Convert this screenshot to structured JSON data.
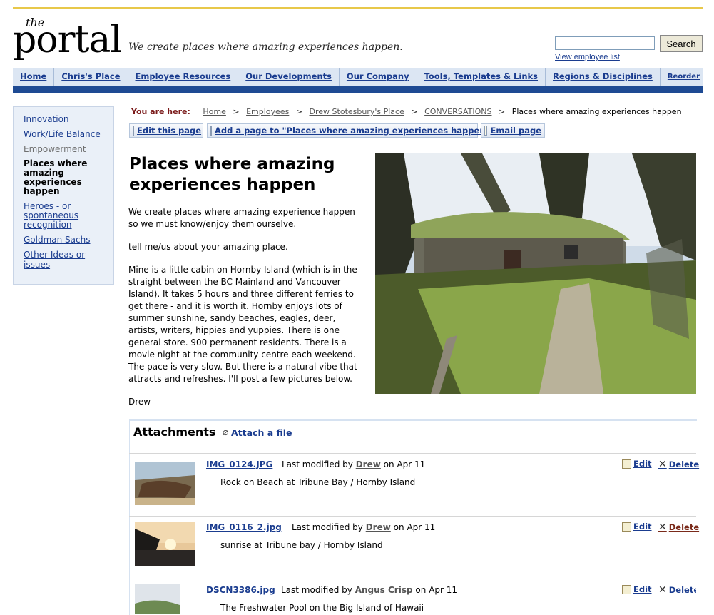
{
  "logo": {
    "the": "the",
    "portal": "portal"
  },
  "tagline": "We create places where amazing experiences happen.",
  "search": {
    "button": "Search",
    "employee_link": "View employee list"
  },
  "nav": [
    {
      "label": "Home"
    },
    {
      "label": "Chris's Place"
    },
    {
      "label": "Employee Resources"
    },
    {
      "label": "Our Developments"
    },
    {
      "label": "Our Company"
    },
    {
      "label": "Tools, Templates & Links"
    },
    {
      "label": "Regions & Disciplines"
    },
    {
      "label": "Reorder"
    }
  ],
  "sidebar": {
    "innovation": "Innovation",
    "worklife": "Work/Life Balance",
    "empowerment": "Empowerment",
    "current": "Places where amazing experiences happen",
    "heroes": "Heroes - or spontaneous recognition",
    "goldman": "Goldman Sachs",
    "other": "Other Ideas or issues"
  },
  "breadcrumb": {
    "label": "You are here:",
    "sep": ">",
    "home": "Home",
    "employees": "Employees",
    "drew_place": "Drew Stotesbury's Place",
    "conversations": "CONVERSATIONS",
    "current": "Places where amazing experiences happen"
  },
  "toolbar": {
    "edit": "Edit this page",
    "add": "Add a page to \"Places where amazing experiences happen\"",
    "email": "Email page"
  },
  "page": {
    "title": "Places where amazing experiences happen",
    "p1": "We create places where amazing experience happen so we must know/enjoy them ourselve.",
    "p2": "tell me/us about your amazing place.",
    "p3": "Mine is a little cabin on Hornby Island (which is in the straight between the BC Mainland and Vancouver Island). It takes 5 hours and three different ferries to get there - and it is worth it. Hornby enjoys lots of summer sunshine, sandy beaches, eagles, deer, artists, writers, hippies and yuppies. There is one general store. 900 permanent residents. There is a movie night at the community centre each weekend. The pace is very slow. But there is a natural vibe that attracts and refreshes. I'll post a few pictures below.",
    "p4": "Drew"
  },
  "attachments": {
    "title": "Attachments",
    "attach_link": "Attach a file",
    "modified_prefix": "Last modified by",
    "on": "on",
    "edit": "Edit",
    "delete": "Delete",
    "items": [
      {
        "file": "IMG_0124.JPG",
        "author": "Drew",
        "date": "Apr 11",
        "desc": "Rock on Beach at Tribune Bay / Hornby Island"
      },
      {
        "file": "IMG_0116_2.jpg",
        "author": "Drew",
        "date": "Apr 11",
        "desc": "sunrise at Tribune bay / Hornby Island"
      },
      {
        "file": "DSCN3386.jpg",
        "author": "Angus Crisp",
        "date": "Apr 11",
        "desc": "The Freshwater Pool on the Big Island of Hawaii"
      }
    ]
  }
}
